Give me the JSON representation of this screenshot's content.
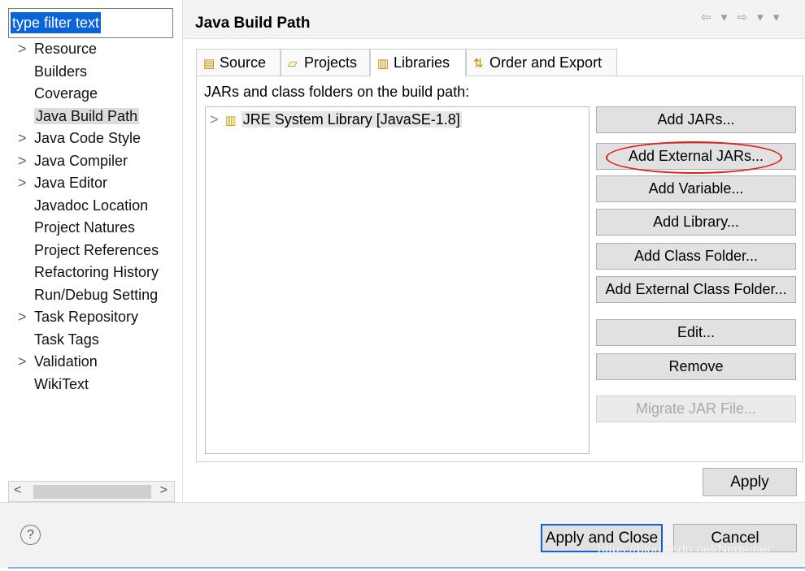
{
  "filter": {
    "value": "type filter text"
  },
  "nav": {
    "items": [
      {
        "label": "Resource",
        "expandable": true
      },
      {
        "label": "Builders",
        "expandable": false
      },
      {
        "label": "Coverage",
        "expandable": false
      },
      {
        "label": "Java Build Path",
        "expandable": false,
        "selected": true
      },
      {
        "label": "Java Code Style",
        "expandable": true
      },
      {
        "label": "Java Compiler",
        "expandable": true
      },
      {
        "label": "Java Editor",
        "expandable": true
      },
      {
        "label": "Javadoc Location",
        "expandable": false
      },
      {
        "label": "Project Natures",
        "expandable": false
      },
      {
        "label": "Project References",
        "expandable": false
      },
      {
        "label": "Refactoring History",
        "expandable": false
      },
      {
        "label": "Run/Debug Setting",
        "expandable": false
      },
      {
        "label": "Task Repository",
        "expandable": true
      },
      {
        "label": "Task Tags",
        "expandable": false
      },
      {
        "label": "Validation",
        "expandable": true
      },
      {
        "label": "WikiText",
        "expandable": false
      }
    ],
    "chevron": ">"
  },
  "header": {
    "title": "Java Build Path",
    "history": "⇦ ▾ ⇨ ▾ ▾"
  },
  "tabs": [
    {
      "label": "Source",
      "icon": "source-folder-icon"
    },
    {
      "label": "Projects",
      "icon": "projects-icon"
    },
    {
      "label": "Libraries",
      "icon": "libraries-icon",
      "active": true
    },
    {
      "label": "Order and Export",
      "icon": "order-export-icon"
    }
  ],
  "libraries": {
    "panel_label": "JARs and class folders on the build path:",
    "tree_items": [
      {
        "label": "JRE System Library [JavaSE-1.8]"
      }
    ],
    "buttons": {
      "add_jars": "Add JARs...",
      "add_external_jars": "Add External JARs...",
      "add_variable": "Add Variable...",
      "add_library": "Add Library...",
      "add_class_folder": "Add Class Folder...",
      "add_external_class_folder": "Add External Class Folder...",
      "edit": "Edit...",
      "remove": "Remove",
      "migrate_jar": "Migrate JAR File..."
    }
  },
  "apply_label": "Apply",
  "footer": {
    "help": "?",
    "apply_and_close": "Apply and Close",
    "cancel": "Cancel",
    "watermark": "https://blog.csdn.net/Nodemer"
  },
  "colors": {
    "selection": "#0a64d8",
    "highlight_oval": "#e0201a"
  }
}
